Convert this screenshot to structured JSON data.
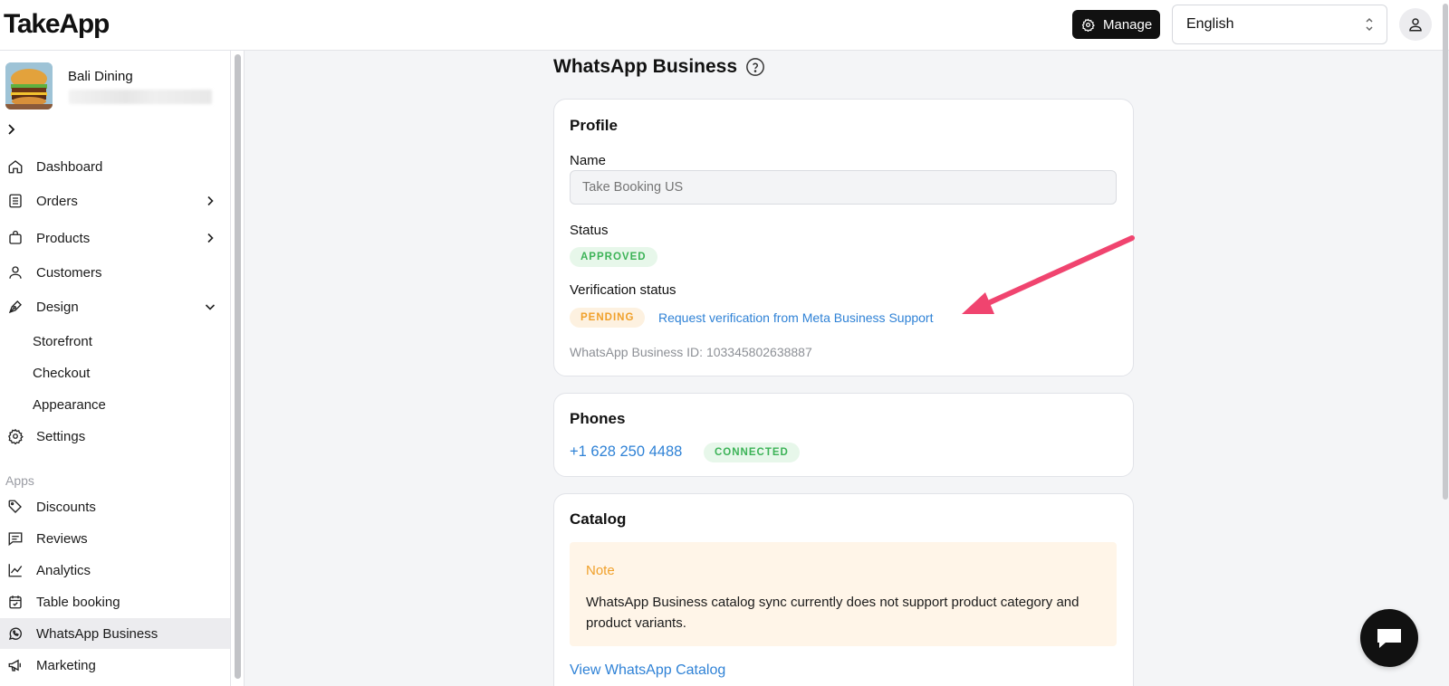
{
  "app": {
    "logo": "TakeApp"
  },
  "header": {
    "manage_label": "Manage",
    "language": {
      "selected": "English"
    }
  },
  "sidebar": {
    "store_name": "Bali Dining",
    "items": [
      {
        "label": "Dashboard",
        "icon": "home-icon"
      },
      {
        "label": "Orders",
        "icon": "orders-icon"
      },
      {
        "label": "Products",
        "icon": "products-icon"
      },
      {
        "label": "Customers",
        "icon": "user-icon"
      },
      {
        "label": "Design",
        "icon": "pen-icon"
      },
      {
        "label": "Storefront"
      },
      {
        "label": "Checkout"
      },
      {
        "label": "Appearance"
      },
      {
        "label": "Settings",
        "icon": "gear-icon"
      }
    ],
    "apps_label": "Apps",
    "apps": [
      {
        "label": "Discounts",
        "icon": "tag-icon"
      },
      {
        "label": "Reviews",
        "icon": "reviews-icon"
      },
      {
        "label": "Analytics",
        "icon": "chart-icon"
      },
      {
        "label": "Table booking",
        "icon": "calendar-icon"
      },
      {
        "label": "WhatsApp Business",
        "icon": "whatsapp-icon",
        "active": true
      },
      {
        "label": "Marketing",
        "icon": "megaphone-icon"
      }
    ]
  },
  "main": {
    "title": "WhatsApp Business",
    "profile": {
      "title": "Profile",
      "name_label": "Name",
      "name_placeholder": "Take Booking US",
      "status_label": "Status",
      "status_badge": "APPROVED",
      "verification_label": "Verification status",
      "verification_badge": "PENDING",
      "verification_link": "Request verification from Meta Business Support",
      "business_id": "WhatsApp Business ID: 103345802638887"
    },
    "phones": {
      "title": "Phones",
      "number": "+1 628 250 4488",
      "badge": "CONNECTED"
    },
    "catalog": {
      "title": "Catalog",
      "note_title": "Note",
      "note_text": "WhatsApp Business catalog sync currently does not support product category and product variants.",
      "view_link": "View WhatsApp Catalog"
    }
  },
  "colors": {
    "accent_link": "#2f82d6",
    "approved_green": "#3cb357",
    "pending_orange": "#f0a02a",
    "annotation_arrow": "#f0446f"
  }
}
